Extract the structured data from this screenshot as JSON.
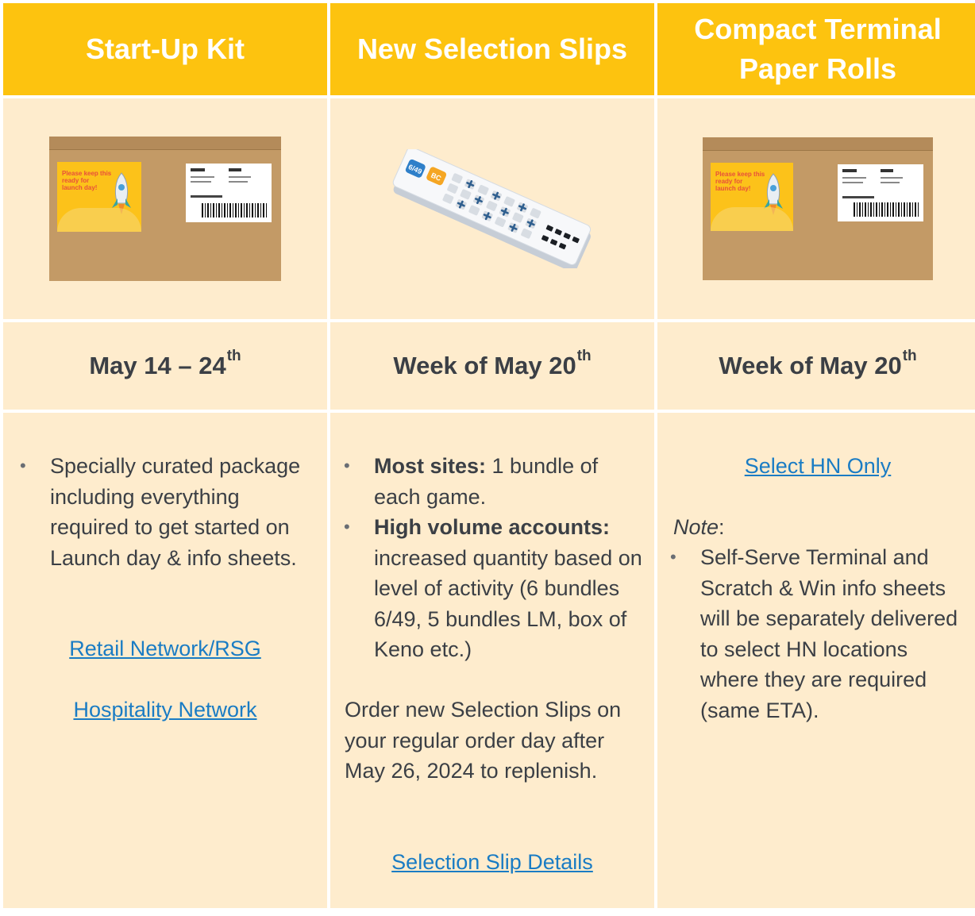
{
  "headers": [
    {
      "text": "Start-Up Kit"
    },
    {
      "lines": [
        "Compact Terminal",
        "Paper Rolls"
      ]
    },
    {
      "text": "New Selection Slips"
    }
  ],
  "dates": [
    {
      "main": "May 14 – 24",
      "sup": "th"
    },
    {
      "main": "Week of May 20",
      "sup": "th"
    },
    {
      "main": "Week of May 20",
      "sup": "th"
    }
  ],
  "col1": {
    "bullet": "Specially curated package including everything required to get started on Launch day & info sheets.",
    "links": [
      "Retail Network/RSG",
      "Hospitality Network"
    ]
  },
  "col2": {
    "bullets": [
      {
        "bold": "Most sites:",
        "text": " 1 bundle of each game."
      },
      {
        "bold": "High volume accounts:",
        "text": " increased quantity based on level of activity (6 bundles 6/49, 5 bundles LM, box of Keno etc.)"
      }
    ],
    "paragraph": "Order new Selection Slips on your regular order day after May 26, 2024 to replenish.",
    "link": "Selection Slip Details"
  },
  "col3": {
    "link": "Select HN Only",
    "note_label": "Note",
    "note_colon": ":",
    "bullet": "Self-Serve Terminal and Scratch & Win info sheets will be separately delivered to select HN locations where they are required (same ETA)."
  },
  "box_label": {
    "lines": [
      "Please keep this",
      "ready for",
      "launch day!"
    ]
  },
  "slip_logos": [
    "6/49",
    "BC"
  ],
  "colors": {
    "header": "#fdc30f",
    "cell": "#feeccd",
    "link": "#1a7cc4",
    "text": "#3b3f45"
  }
}
